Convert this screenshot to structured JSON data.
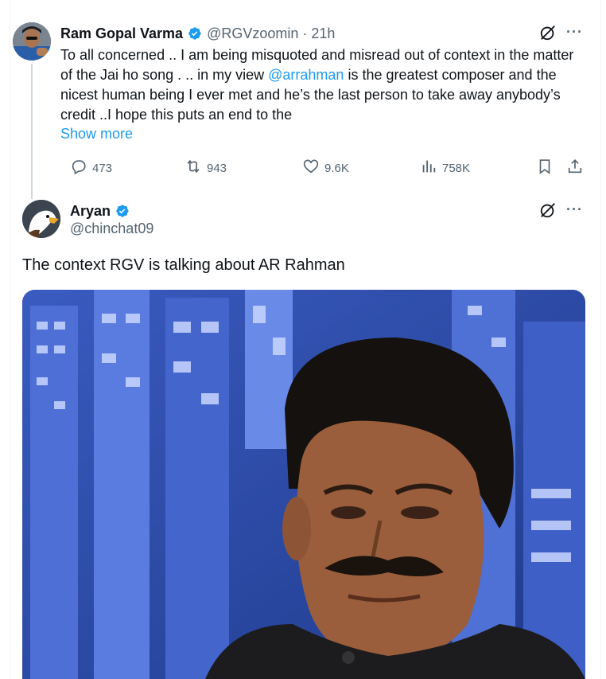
{
  "tweet1": {
    "author_name": "Ram Gopal Varma",
    "handle": "@RGVzoomin",
    "separator": "·",
    "time": "21h",
    "body_before": "To all concerned .. I am being misquoted and misread out of context in the matter of the Jai ho song . .. in my view ",
    "mention": "@arrahman",
    "body_after": " is the greatest composer and the nicest human being I ever met and he’s the last person to take away anybody’s credit ..I hope this puts an end to the",
    "show_more": "Show more",
    "replies": "473",
    "reposts": "943",
    "likes": "9.6K",
    "views": "758K"
  },
  "tweet2": {
    "author_name": "Aryan",
    "handle": "@chinchat09",
    "text": "The context RGV is talking about AR Rahman"
  },
  "icons": [
    "verified-badge-icon",
    "grok-icon",
    "more-icon",
    "reply-icon",
    "repost-icon",
    "like-icon",
    "views-icon",
    "bookmark-icon",
    "share-icon"
  ],
  "colors": {
    "accent": "#1d9bf0",
    "secondary_text": "#536471",
    "primary_text": "#0f1419"
  }
}
